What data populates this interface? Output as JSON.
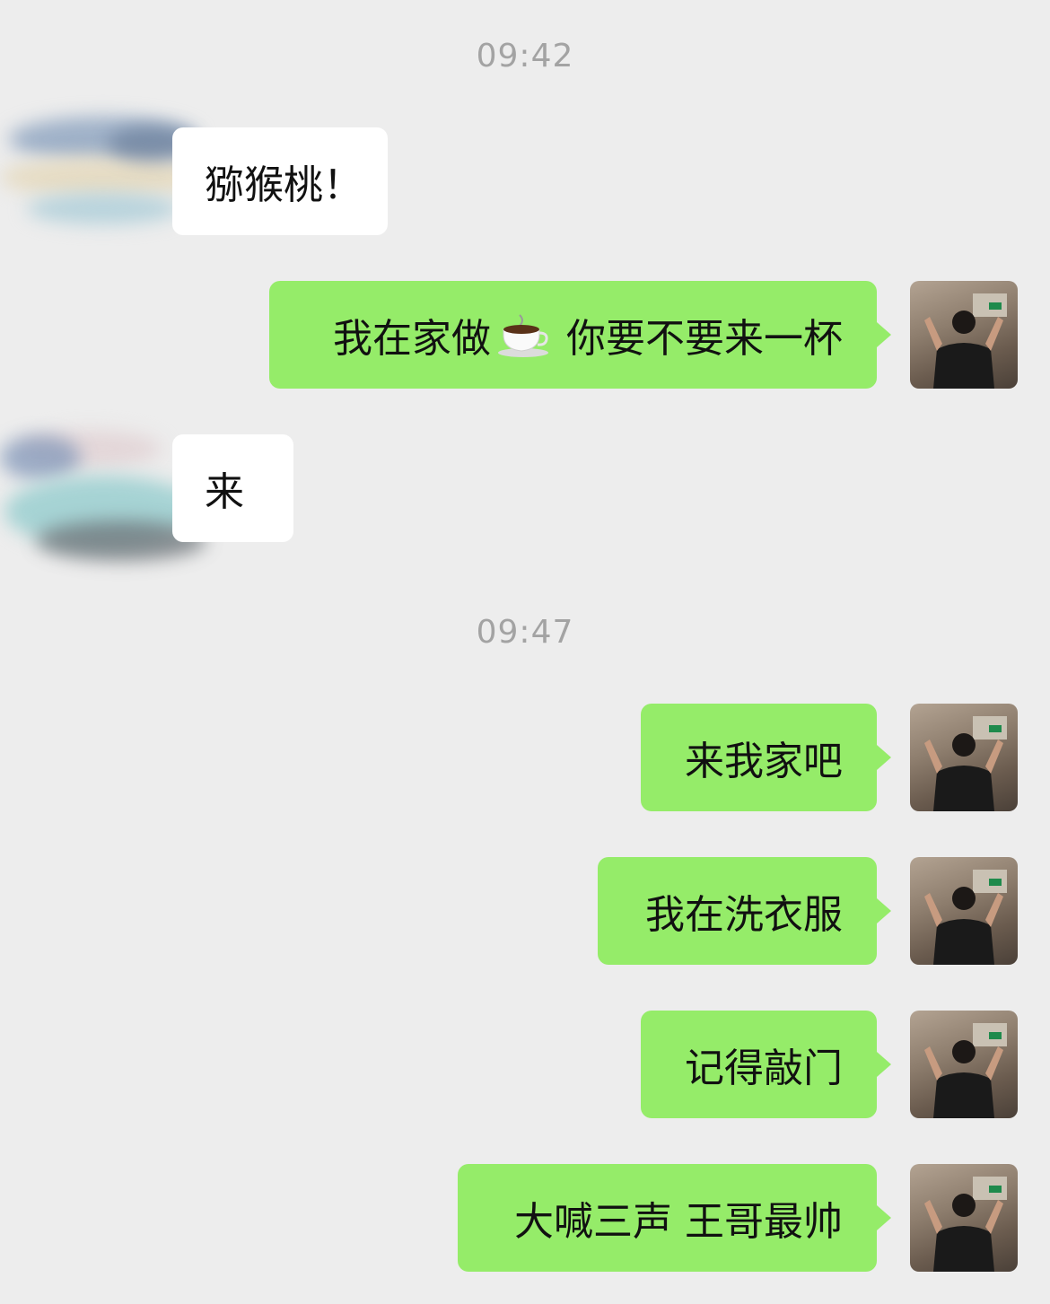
{
  "timestamps": [
    "09:42",
    "09:47"
  ],
  "messages": [
    {
      "sender": "other",
      "text": "猕猴桃！"
    },
    {
      "sender": "me",
      "text_before": "我在家做",
      "emoji": "coffee-cup",
      "text_after": "你要不要来一杯"
    },
    {
      "sender": "other",
      "text": "来"
    },
    {
      "sender": "me",
      "text": "来我家吧"
    },
    {
      "sender": "me",
      "text": "我在洗衣服"
    },
    {
      "sender": "me",
      "text": "记得敲门"
    },
    {
      "sender": "me",
      "text": "大喊三声 王哥最帅"
    }
  ],
  "colors": {
    "background": "#ededed",
    "my_bubble": "#95ec69",
    "other_bubble": "#ffffff",
    "timestamp": "#a3a3a3"
  }
}
